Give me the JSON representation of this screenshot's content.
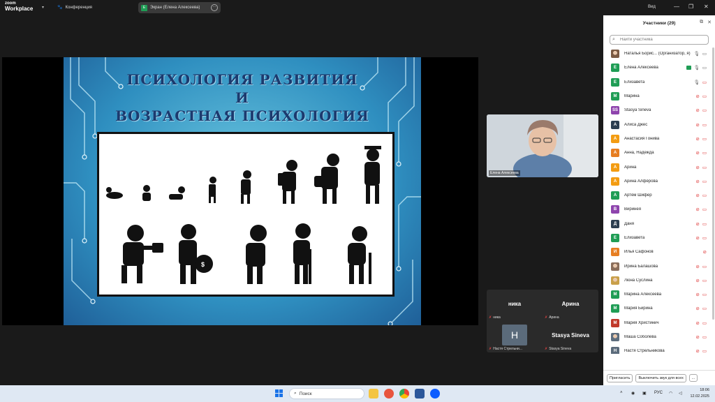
{
  "app": {
    "logo_line1": "zoom",
    "logo_line2": "Workplace",
    "meeting_label": "Конференция",
    "share_indicator": "Экран (Елена Алексеева)",
    "share_avatar_letter": "E",
    "view_label": "Вид"
  },
  "slide": {
    "title_lines": [
      "ПСИХОЛОГИЯ РАЗВИТИЯ",
      "И",
      "ВОЗРАСТНАЯ ПСИХОЛОГИЯ"
    ]
  },
  "self_video": {
    "name": "Елена Алексеева"
  },
  "gallery": {
    "tiles": [
      {
        "big": "ника",
        "label": "ника"
      },
      {
        "big": "Арина",
        "label": "Арина"
      },
      {
        "big": "",
        "avatar_letter": "Н",
        "label": "Настя Стрельни..."
      },
      {
        "big": "Stasya Sineva",
        "label": "Stasya Sineva"
      }
    ]
  },
  "participants_panel": {
    "title": "Участники (29)",
    "search_placeholder": "Найти участника",
    "invite_label": "Пригласить",
    "mute_all_label": "Выключить звук для всех",
    "more_label": "...",
    "items": [
      {
        "letter": "",
        "color": "#7a5a44",
        "photo": true,
        "name": "Наталья Борис... (Организатор, я)",
        "mic": "on",
        "cam": "on"
      },
      {
        "letter": "Е",
        "color": "#1f9d55",
        "name": "Елена Алексеева",
        "share": true,
        "mic": "on",
        "cam": "on"
      },
      {
        "letter": "Е",
        "color": "#1f9d55",
        "name": "Елизавета",
        "mic": "on",
        "cam": "off"
      },
      {
        "letter": "М",
        "color": "#1f9d55",
        "name": "Марина",
        "mic": "off",
        "cam": "off"
      },
      {
        "letter": "SS",
        "color": "#8e44ad",
        "name": "Stasya Sineva",
        "mic": "off",
        "cam": "off"
      },
      {
        "letter": "А",
        "color": "#2c3e50",
        "name": "Алиса Джес",
        "mic": "off",
        "cam": "off"
      },
      {
        "letter": "А",
        "color": "#f39c12",
        "name": "Анастасия Гонива",
        "mic": "off",
        "cam": "off"
      },
      {
        "letter": "А",
        "color": "#e67e22",
        "name": "Анна, Надежда",
        "mic": "off",
        "cam": "off"
      },
      {
        "letter": "А",
        "color": "#f39c12",
        "name": "Арина",
        "mic": "off",
        "cam": "off"
      },
      {
        "letter": "А",
        "color": "#f39c12",
        "name": "Арина Алфёрова",
        "mic": "off",
        "cam": "off"
      },
      {
        "letter": "А",
        "color": "#1f9d55",
        "name": "Артём Шифер",
        "mic": "off",
        "cam": "off"
      },
      {
        "letter": "В",
        "color": "#8e44ad",
        "name": "Виринея",
        "mic": "off",
        "cam": "off"
      },
      {
        "letter": "Д",
        "color": "#2c3e50",
        "name": "Даня",
        "mic": "off",
        "cam": "off"
      },
      {
        "letter": "Е",
        "color": "#1f9d55",
        "name": "Елизавета",
        "mic": "off",
        "cam": "off"
      },
      {
        "letter": "И",
        "color": "#e67e22",
        "name": "Илья Сафонов",
        "mic": "off",
        "cam": "none"
      },
      {
        "letter": "",
        "color": "#8a6d5b",
        "photo": true,
        "name": "Ирина Балашова",
        "mic": "off",
        "cam": "off"
      },
      {
        "letter": "",
        "color": "#c9a04a",
        "photo": true,
        "name": "Люна Суслина",
        "mic": "off",
        "cam": "off"
      },
      {
        "letter": "М",
        "color": "#1f9d55",
        "name": "Марина Алексеева",
        "mic": "off",
        "cam": "off"
      },
      {
        "letter": "М",
        "color": "#1f9d55",
        "name": "Мария Бирина",
        "mic": "off",
        "cam": "off"
      },
      {
        "letter": "М",
        "color": "#c0392b",
        "name": "Мария Христинич",
        "mic": "off",
        "cam": "off"
      },
      {
        "letter": "",
        "color": "#5d6d7e",
        "photo": true,
        "name": "Маша Соболева",
        "mic": "off",
        "cam": "off"
      },
      {
        "letter": "Н",
        "color": "#5b6b7b",
        "name": "Настя Стрельникова",
        "mic": "off",
        "cam": "off"
      }
    ]
  },
  "taskbar": {
    "search_label": "Поиск",
    "lang": "РУС",
    "time": "18:06",
    "date": "12.02.2025"
  },
  "colors": {
    "accent_green": "#1f9d55",
    "muted_red": "#d33333",
    "slide_blue": "#2f8fc0"
  }
}
